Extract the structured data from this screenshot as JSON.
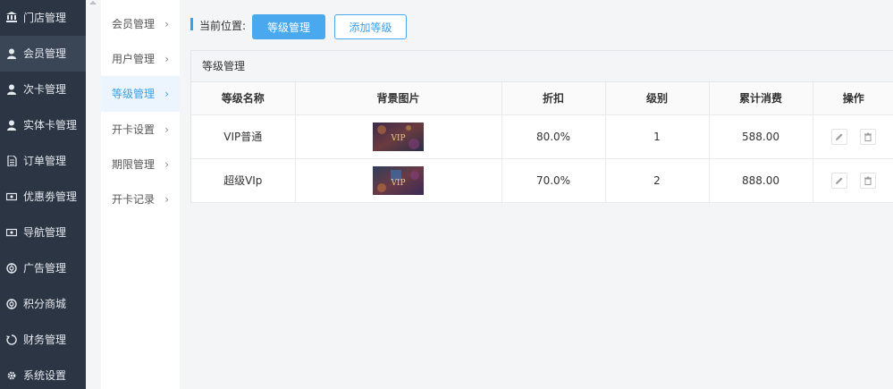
{
  "sidebar": {
    "items": [
      {
        "label": "门店管理",
        "icon": "bank-icon"
      },
      {
        "label": "会员管理",
        "icon": "user-icon"
      },
      {
        "label": "次卡管理",
        "icon": "user-icon"
      },
      {
        "label": "实体卡管理",
        "icon": "user-icon"
      },
      {
        "label": "订单管理",
        "icon": "document-icon"
      },
      {
        "label": "优惠劵管理",
        "icon": "ticket-icon"
      },
      {
        "label": "导航管理",
        "icon": "ticket-icon"
      },
      {
        "label": "广告管理",
        "icon": "lifebuoy-icon"
      },
      {
        "label": "积分商城",
        "icon": "lifebuoy-icon"
      },
      {
        "label": "财务管理",
        "icon": "recycle-icon"
      },
      {
        "label": "系统设置",
        "icon": "gear-icon"
      }
    ]
  },
  "submenu": {
    "items": [
      {
        "label": "会员管理"
      },
      {
        "label": "用户管理"
      },
      {
        "label": "等级管理"
      },
      {
        "label": "开卡设置"
      },
      {
        "label": "期限管理"
      },
      {
        "label": "开卡记录"
      }
    ],
    "chevron": "›"
  },
  "breadcrumb": {
    "label": "当前位置:",
    "current_button": "等级管理",
    "add_button": "添加等级"
  },
  "panel": {
    "title": "等级管理",
    "columns": [
      "等级名称",
      "背景图片",
      "折扣",
      "级别",
      "累计消费",
      "操作"
    ],
    "rows": [
      {
        "name": "VIP普通",
        "thumb_text": "VIP",
        "discount": "80.0%",
        "level": "1",
        "total": "588.00"
      },
      {
        "name": "超级VIp",
        "thumb_text": "VIP",
        "discount": "70.0%",
        "level": "2",
        "total": "888.00"
      }
    ]
  },
  "colors": {
    "accent": "#39a0ec",
    "sidebar_bg": "#2b3543",
    "sidebar_active": "#3a4556"
  }
}
